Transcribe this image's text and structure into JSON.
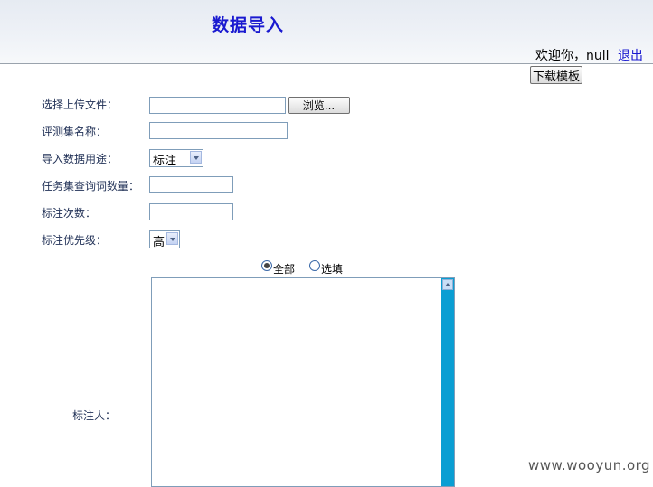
{
  "header": {
    "title": "数据导入",
    "welcome": "欢迎你，null",
    "logout": "退出"
  },
  "toolbar": {
    "download_template": "下载模板"
  },
  "form": {
    "file_label": "选择上传文件：",
    "file_value": "",
    "browse_label": "浏览...",
    "eval_set_label": "评测集名称：",
    "eval_set_value": "",
    "usage_label": "导入数据用途：",
    "usage_value": "标注",
    "query_count_label": "任务集查询词数量：",
    "query_count_value": "",
    "annotate_times_label": "标注次数：",
    "annotate_times_value": "",
    "priority_label": "标注优先级：",
    "priority_value": "高",
    "radio_all": "全部",
    "radio_select": "选填",
    "radio_selected": "全部",
    "annotator_label": "标注人："
  },
  "watermark": "www.wooyun.org"
}
